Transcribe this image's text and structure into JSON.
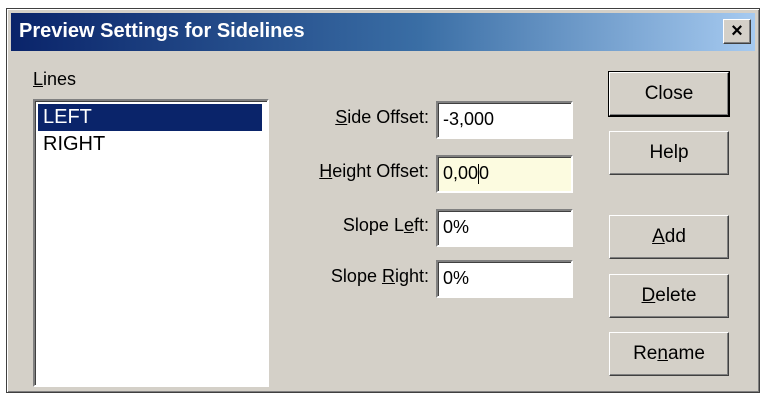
{
  "window": {
    "title": "Preview Settings for Sidelines",
    "close_glyph": "✕"
  },
  "lines": {
    "label_first": "L",
    "label_rest": "ines",
    "items": [
      "LEFT",
      "RIGHT"
    ],
    "selected": "LEFT"
  },
  "fields": {
    "side_offset": {
      "label_accel": "S",
      "label_rest": "ide Offset:",
      "value": "-3,000"
    },
    "height_offset": {
      "label_accel": "H",
      "label_rest": "eight Offset:",
      "value_before_caret": "0,00",
      "value_after_caret": "0"
    },
    "slope_left": {
      "label_pre": "Slope L",
      "label_accel": "e",
      "label_post": "ft:",
      "value": "0%"
    },
    "slope_right": {
      "label_pre": "Slope ",
      "label_accel": "R",
      "label_post": "ight:",
      "value": "0%"
    }
  },
  "buttons": {
    "close": "Close",
    "help": "Help",
    "add_accel": "A",
    "add_rest": "dd",
    "delete_accel": "D",
    "delete_rest": "elete",
    "rename_pre": "Re",
    "rename_accel": "n",
    "rename_post": "ame"
  },
  "colors": {
    "title_start": "#0a246a",
    "selection": "#0a246a",
    "dialog_face": "#d4d0c8",
    "focused_field": "#fcfbe0"
  }
}
